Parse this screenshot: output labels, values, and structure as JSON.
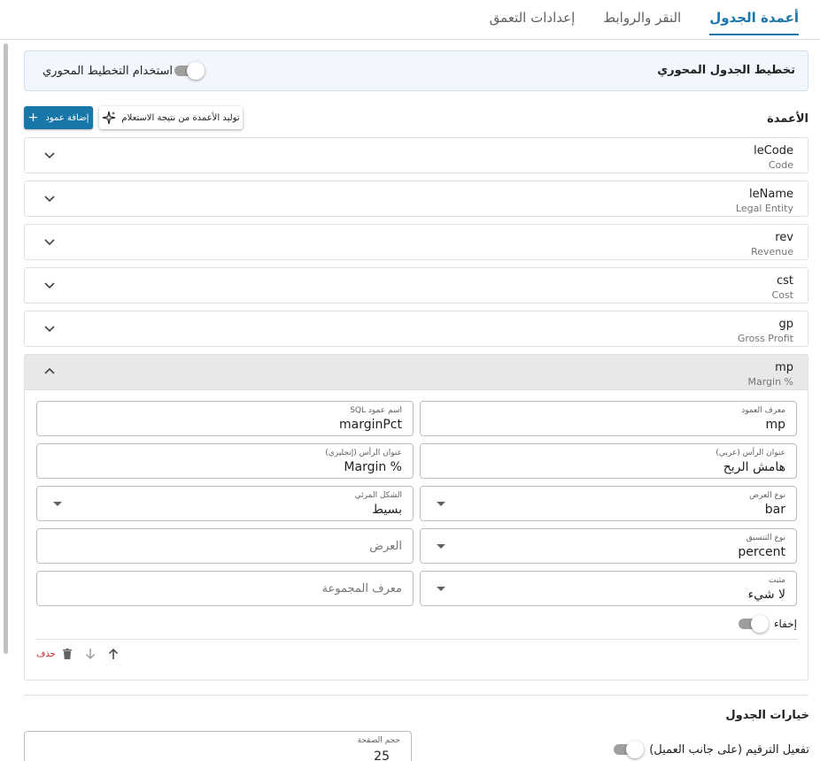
{
  "tabs": [
    {
      "label": "أعمدة الجدول",
      "active": true
    },
    {
      "label": "النقر والروابط",
      "active": false
    },
    {
      "label": "إعدادات التعمق",
      "active": false
    }
  ],
  "pivot": {
    "title": "تخطيط الجدول المحوري",
    "toggle_label": "استخدام التخطيط المحوري",
    "toggle_on": false
  },
  "columns_section": {
    "title": "الأعمدة",
    "add_label": "إضافة عمود",
    "generate_label": "توليد الأعمدة من نتيجة الاستعلام"
  },
  "columns": [
    {
      "name": "leCode",
      "caption": "Code"
    },
    {
      "name": "leName",
      "caption": "Legal Entity"
    },
    {
      "name": "rev",
      "caption": "Revenue"
    },
    {
      "name": "cst",
      "caption": "Cost"
    },
    {
      "name": "gp",
      "caption": "Gross Profit"
    },
    {
      "name": "mp",
      "caption": "% Margin"
    }
  ],
  "detail": {
    "column_id_label": "معرف العمود",
    "column_id_value": "mp",
    "sql_name_label": "اسم عمود SQL",
    "sql_name_value": "marginPct",
    "header_ar_label": "عنوان الرأس (عربي)",
    "header_ar_value": "هامش الربح",
    "header_en_label": "عنوان الرأس (إنجليزي)",
    "header_en_value": "% Margin",
    "display_type_label": "نوع العرض",
    "display_type_value": "bar",
    "visual_style_label": "الشكل المرئي",
    "visual_style_value": "بسيط",
    "format_type_label": "نوع التنسيق",
    "format_type_value": "percent",
    "width_placeholder": "العرض",
    "pinned_label": "مثبت",
    "pinned_value": "لا شيء",
    "group_id_placeholder": "معرف المجموعة",
    "hide_label": "إخفاء",
    "delete_label": "حذف"
  },
  "table_options": {
    "title": "خيارات الجدول",
    "pagination_label": "تفعيل الترقيم (على جانب العميل)",
    "page_size_label": "حجم الصفحة",
    "page_size_value": "25"
  },
  "colors": {
    "accent": "#1976a8",
    "danger": "#c62828"
  }
}
